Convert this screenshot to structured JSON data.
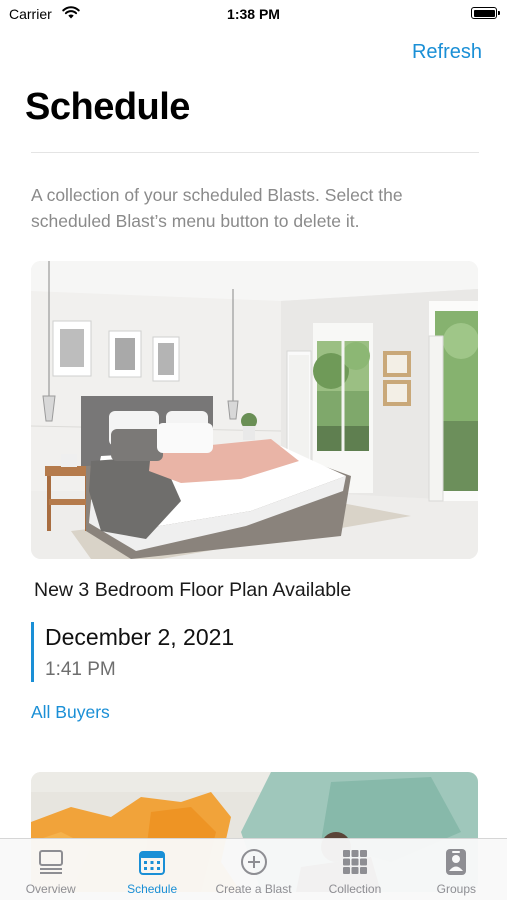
{
  "status_bar": {
    "carrier": "Carrier",
    "time": "1:38 PM"
  },
  "header": {
    "refresh_label": "Refresh",
    "title": "Schedule"
  },
  "description": "A collection of your scheduled Blasts. Select the scheduled Blast’s menu button to delete it.",
  "blasts": [
    {
      "title": "New 3 Bedroom Floor Plan Available",
      "date": "December 2, 2021",
      "time": "1:41 PM",
      "audience": "All Buyers",
      "image": "bedroom-photo"
    },
    {
      "image": "abstract-painting"
    }
  ],
  "tab_bar": {
    "items": [
      {
        "label": "Overview",
        "icon": "overview-icon",
        "active": false
      },
      {
        "label": "Schedule",
        "icon": "calendar-icon",
        "active": true
      },
      {
        "label": "Create a Blast",
        "icon": "plus-circle-icon",
        "active": false
      },
      {
        "label": "Collection",
        "icon": "grid-icon",
        "active": false
      },
      {
        "label": "Groups",
        "icon": "groups-icon",
        "active": false
      }
    ]
  },
  "colors": {
    "accent": "#1a8fd6",
    "muted_text": "#8a8a8a",
    "inactive_tab": "#8e8e93"
  }
}
